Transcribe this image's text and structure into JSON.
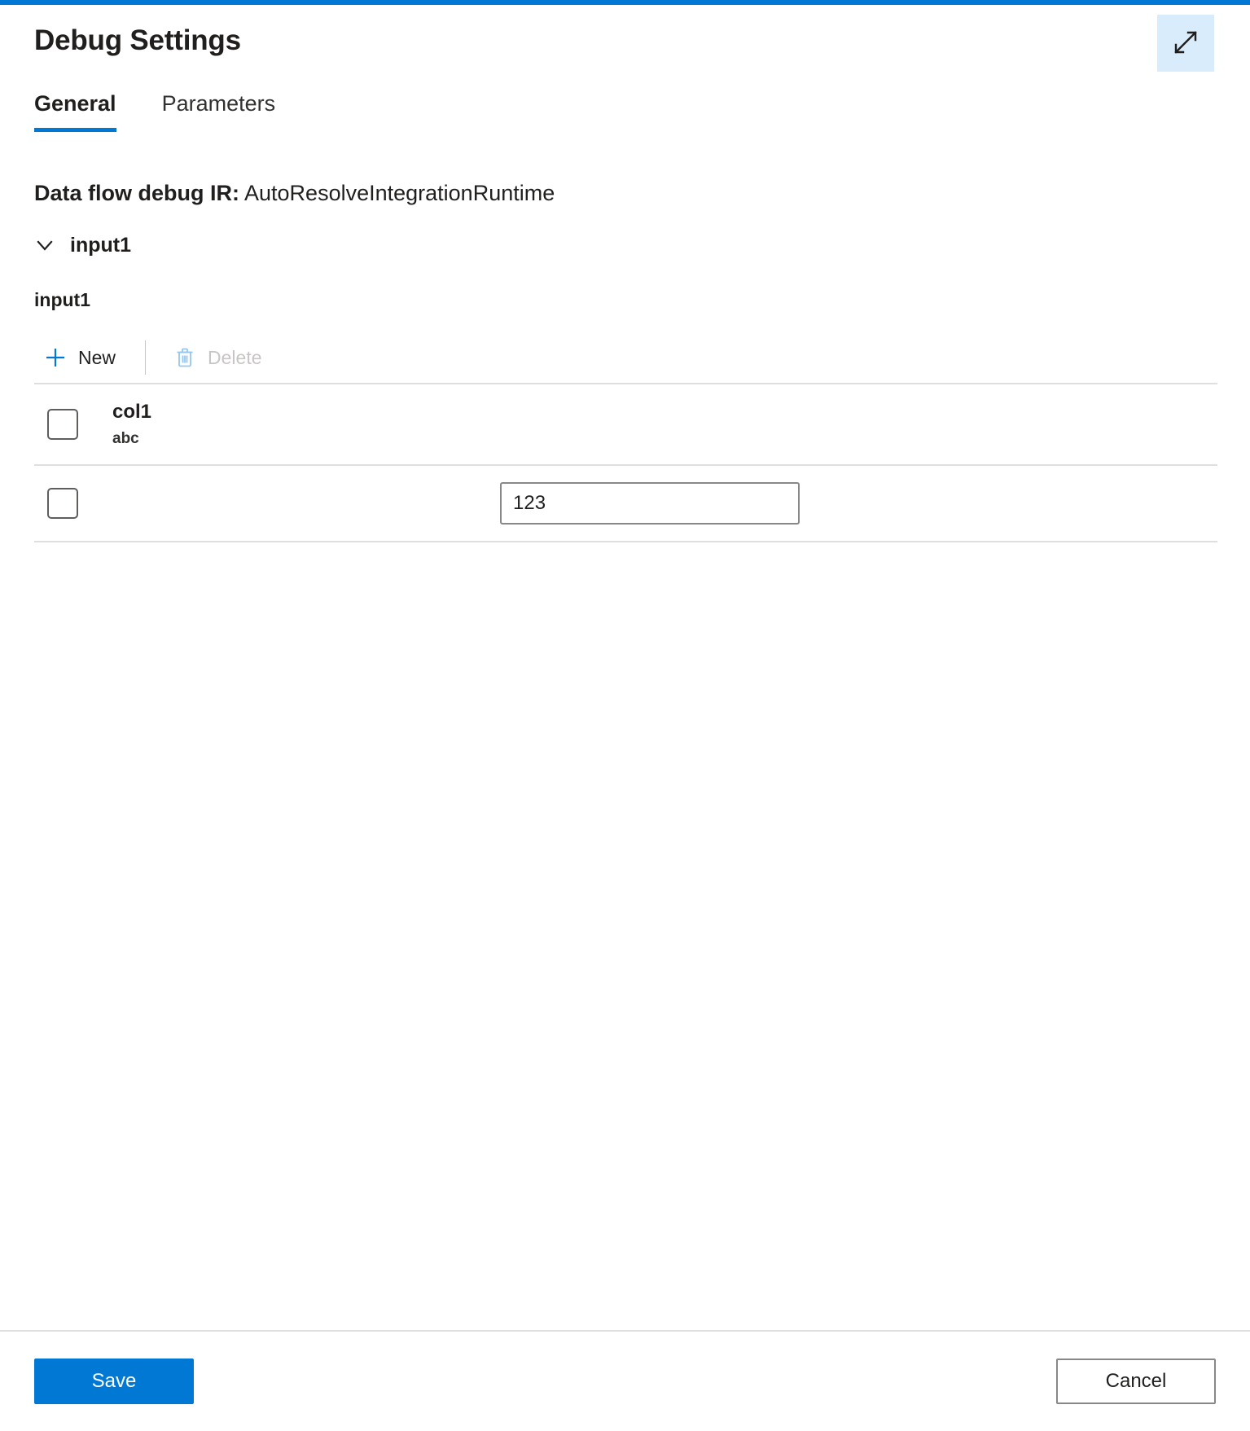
{
  "accent_color": "#0078d4",
  "header": {
    "title": "Debug Settings",
    "expand_icon": "expand-diagonal-icon"
  },
  "tabs": [
    {
      "label": "General",
      "active": true
    },
    {
      "label": "Parameters",
      "active": false
    }
  ],
  "general": {
    "ir_label": "Data flow debug IR:",
    "ir_value": "AutoResolveIntegrationRuntime",
    "collapse": {
      "icon": "chevron-down-icon",
      "label": "input1",
      "expanded": true
    },
    "stream_name": "input1",
    "toolbar": {
      "new_label": "New",
      "new_icon": "plus-icon",
      "delete_label": "Delete",
      "delete_icon": "trash-icon",
      "delete_disabled": true
    },
    "table": {
      "header": {
        "checkbox_checked": false,
        "column_name": "col1",
        "column_type": "abc"
      },
      "rows": [
        {
          "checkbox_checked": false,
          "value": "123"
        }
      ]
    }
  },
  "footer": {
    "save_label": "Save",
    "cancel_label": "Cancel"
  }
}
